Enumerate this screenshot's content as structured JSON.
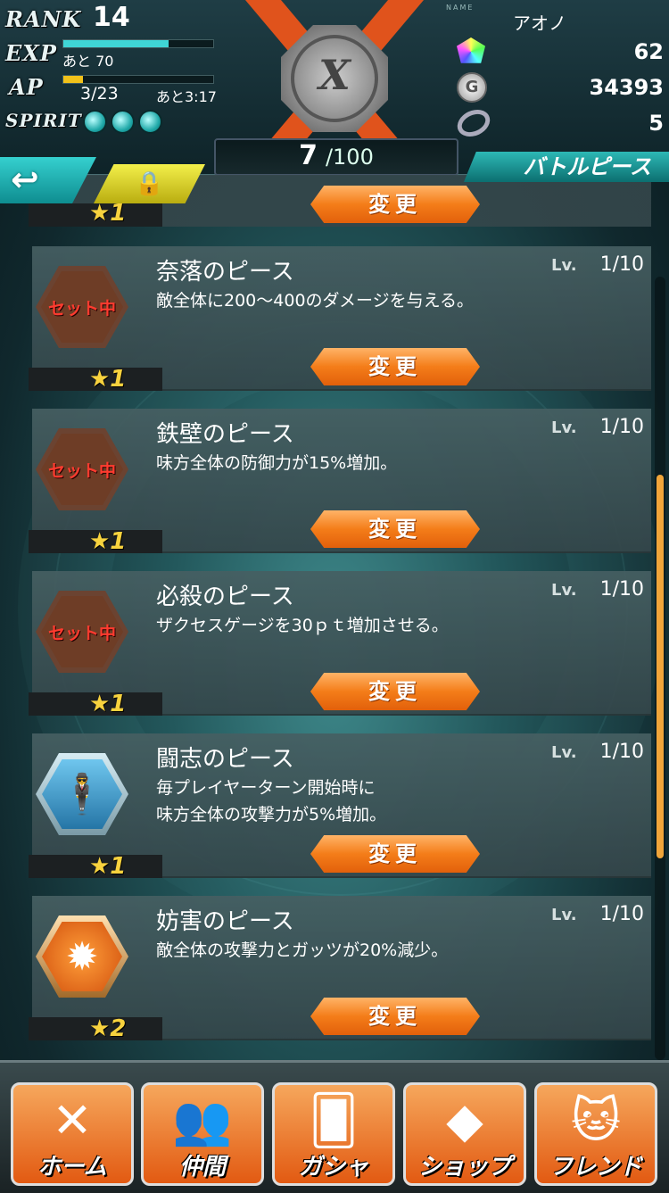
{
  "header": {
    "rank_label": "RANK",
    "rank": "14",
    "exp_label": "EXP",
    "exp_remaining": "あと 70",
    "exp_fill": 0.7,
    "ap_label": "AP",
    "ap_value": "3/23",
    "ap_recovery": "あと3:17",
    "ap_fill": 0.13,
    "spirit_label": "SPIRIT",
    "spirit_count": 3,
    "name_tag": "NAME",
    "player_name": "アオノ",
    "gems": "62",
    "coins": "34393",
    "rings": "5",
    "emblem_letter": "X"
  },
  "counter": {
    "count": "7",
    "total": "/100"
  },
  "section_title": "バトルピース",
  "back_label": "↩",
  "top_card": {
    "stars": "★1",
    "change_label": "変更"
  },
  "pieces": [
    {
      "name": "奈落のピース",
      "lv_label": "Lv.",
      "lv": "1/10",
      "desc": "敵全体に200～400のダメージを与える。",
      "badge": "セット中",
      "stars": "★1",
      "change_label": "変更",
      "icon": "abyss-icon"
    },
    {
      "name": "鉄壁のピース",
      "lv_label": "Lv.",
      "lv": "1/10",
      "desc": "味方全体の防御力が15%増加。",
      "badge": "セット中",
      "stars": "★1",
      "change_label": "変更",
      "icon": "shield-icon"
    },
    {
      "name": "必殺のピース",
      "lv_label": "Lv.",
      "lv": "1/10",
      "desc": "ザクセスゲージを30ｐｔ増加させる。",
      "badge": "セット中",
      "stars": "★1",
      "change_label": "変更",
      "icon": "target-icon"
    },
    {
      "name": "闘志のピース",
      "lv_label": "Lv.",
      "lv": "1/10",
      "desc": "毎プレイヤーターン開始時に\n味方全体の攻撃力が5%増加。",
      "badge": "",
      "stars": "★1",
      "change_label": "変更",
      "icon": "fighter-icon"
    },
    {
      "name": "妨害のピース",
      "lv_label": "Lv.",
      "lv": "1/10",
      "desc": "敵全体の攻撃力とガッツが20%減少。",
      "badge": "",
      "stars": "★2",
      "change_label": "変更",
      "icon": "flame-crest-icon"
    }
  ],
  "nav": [
    {
      "label": "ホーム",
      "icon": "home-x-icon"
    },
    {
      "label": "仲間",
      "icon": "party-icon"
    },
    {
      "label": "ガシャ",
      "icon": "gacha-icon"
    },
    {
      "label": "ショップ",
      "icon": "gem-shop-icon"
    },
    {
      "label": "フレンド",
      "icon": "friend-cats-icon"
    }
  ],
  "colors": {
    "accent_teal": "#2db8b5",
    "button_orange": "#f47d19",
    "set_red": "#ff3b2f",
    "star_yellow": "#f7d23e"
  }
}
